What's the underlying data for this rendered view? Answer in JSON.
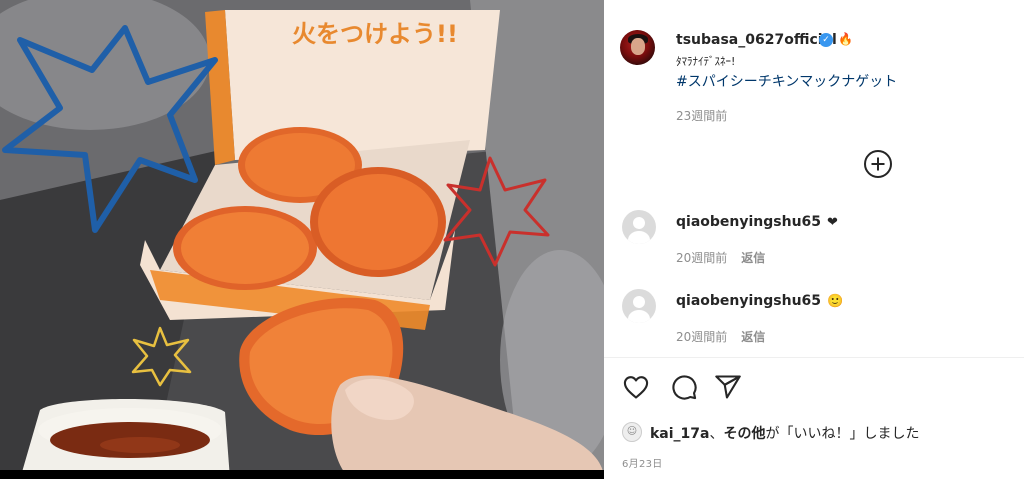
{
  "post": {
    "username": "tsubasa_0627official",
    "verified": true,
    "user_emoji": "🔥",
    "caption": "ﾀﾏﾗﾅｲﾃﾞｽﾈｰ!",
    "hashtag": "#スパイシーチキンマックナゲット",
    "time_ago": "23週間前",
    "photo_text": "火をつけよう!!"
  },
  "comments": [
    {
      "username": "qiaobenyingshu65",
      "text": "❤",
      "time_ago": "20週間前",
      "reply_label": "返信"
    },
    {
      "username": "qiaobenyingshu65",
      "text": "🙂",
      "time_ago": "20週間前",
      "reply_label": "返信"
    }
  ],
  "actions": {
    "like_icon": "heart-icon",
    "comment_icon": "comment-bubble-icon",
    "share_icon": "paper-plane-icon",
    "load_more_icon": "plus-circle-icon"
  },
  "likes": {
    "user": "kai_17a",
    "separator": "、",
    "others": "その他",
    "suffix": "が「いいね！」しました"
  },
  "date": "6月23日",
  "colors": {
    "link": "#00376b",
    "verified": "#3897f0",
    "muted": "#8e8e8e",
    "star_blue": "#1f5fa8",
    "star_red": "#c9302c",
    "star_yellow": "#e8c040"
  }
}
